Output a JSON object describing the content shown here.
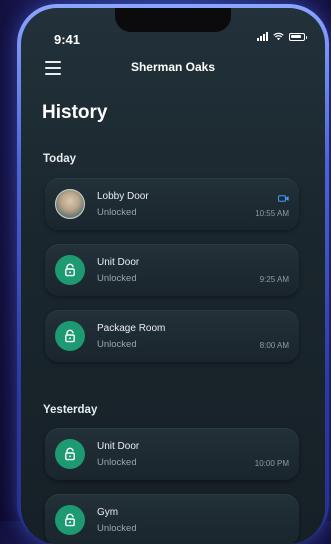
{
  "status_bar": {
    "time": "9:41"
  },
  "header": {
    "location": "Sherman Oaks",
    "menu_icon": "hamburger-menu-icon"
  },
  "page": {
    "title": "History"
  },
  "colors": {
    "accent_green": "#1d9a72",
    "camera_blue": "#3aa0ff",
    "background": "#1a262d"
  },
  "sections": [
    {
      "label": "Today",
      "items": [
        {
          "name": "Lobby Door",
          "status": "Unlocked",
          "time": "10:55 AM",
          "icon": "avatar",
          "has_camera": true
        },
        {
          "name": "Unit Door",
          "status": "Unlocked",
          "time": "9:25 AM",
          "icon": "lock-icon"
        },
        {
          "name": "Package Room",
          "status": "Unlocked",
          "time": "8:00 AM",
          "icon": "lock-icon"
        }
      ]
    },
    {
      "label": "Yesterday",
      "items": [
        {
          "name": "Unit Door",
          "status": "Unlocked",
          "time": "10:00 PM",
          "icon": "lock-icon"
        },
        {
          "name": "Gym",
          "status": "Unlocked",
          "time": "",
          "icon": "lock-icon"
        }
      ]
    }
  ]
}
